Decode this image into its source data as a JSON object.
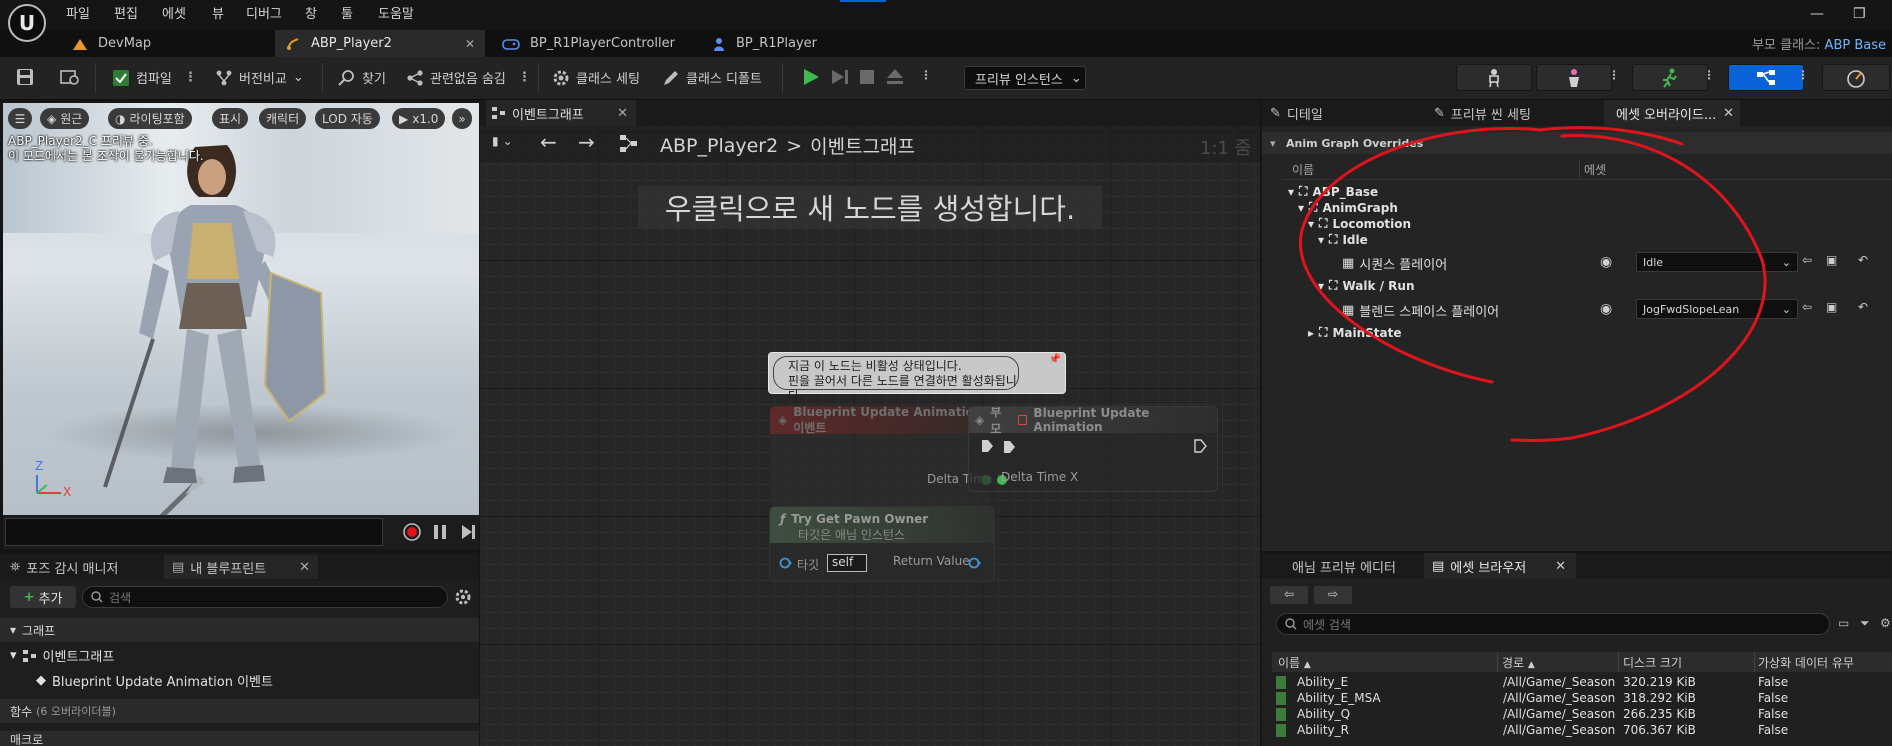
{
  "menu": [
    "파일",
    "편집",
    "에셋",
    "뷰",
    "디버그",
    "창",
    "툴",
    "도움말"
  ],
  "logo_text": "U",
  "tabs": [
    {
      "label": "DevMap"
    },
    {
      "label": "ABP_Player2"
    },
    {
      "label": "BP_R1PlayerController"
    },
    {
      "label": "BP_R1Player"
    }
  ],
  "parent_class": {
    "label": "부모 클래스:",
    "value": "ABP Base"
  },
  "toolbar": {
    "compile": "컴파일",
    "diff": "버전비교",
    "find": "찾기",
    "hide_unrelated": "관련없음 숨김",
    "class_settings": "클래스 세팅",
    "class_defaults": "클래스 디폴트",
    "preview_instance": "프리뷰 인스턴스"
  },
  "viewport": {
    "perspective": "원근",
    "lighting": "라이팅포함",
    "show": "표시",
    "character": "캐릭터",
    "lod": "LOD 자동",
    "speed": "x1.0",
    "message_line1": "ABP_Player2_C 프리뷰 중.",
    "message_line2": "이 모드에서는 본 조작이 불가능합니다.",
    "axis_z": "Z",
    "axis_x": "X"
  },
  "left_tabs": {
    "pose_watch": "포즈 감시 매니저",
    "my_blueprint": "내 블루프린트"
  },
  "my_blueprint": {
    "add": "추가",
    "search_placeholder": "검색",
    "graph_section": "그래프",
    "event_graph": "이벤트그래프",
    "event_item": "Blueprint Update Animation 이벤트",
    "functions_section": "함수",
    "functions_count": "(6 오버라이더블)",
    "macros_section": "매크로"
  },
  "graph": {
    "tab": "이벤트그래프",
    "breadcrumb_root": "ABP_Player2",
    "breadcrumb_sep": ">",
    "breadcrumb_leaf": "이벤트그래프",
    "zoom": "1:1 줌",
    "hint": "우클릭으로 새 노드를 생성합니다.",
    "tooltip_line1": "지금 이 노드는 비활성 상태입니다.",
    "tooltip_line2": "핀을 끌어서 다른 노드를 연결하면 활성화됩니다.",
    "node_event_title": "Blueprint Update Animation 이벤트",
    "node_parent_prefix": "부모",
    "node_parent_title": "Blueprint Update Animation",
    "delta_time": "Delta Time X",
    "pawn_title": "Try Get Pawn Owner",
    "pawn_subtitle": "타깃은 애님 인스턴스",
    "target_label": "타깃",
    "target_value": "self",
    "return_value": "Return Value"
  },
  "right_tabs": {
    "details": "디테일",
    "preview_scene": "프리뷰 씬 세팅",
    "asset_overrides": "에셋 오버라이드..."
  },
  "overrides": {
    "section": "Anim Graph Overrides",
    "col_name": "이름",
    "col_asset": "에셋",
    "tree": {
      "base": "ABP_Base",
      "animgraph": "AnimGraph",
      "locomotion": "Locomotion",
      "idle": "Idle",
      "seq_player": "시퀀스 플레이어",
      "seq_value": "Idle",
      "walkrun": "Walk / Run",
      "bs_player": "블렌드 스페이스 플레이어",
      "bs_value": "JogFwdSlopeLean",
      "mainstate": "MainState"
    }
  },
  "bottom_right_tabs": {
    "anim_preview": "애님 프리뷰 에디터",
    "asset_browser": "에셋 브라우저"
  },
  "asset_browser": {
    "search_placeholder": "에셋 검색",
    "columns": [
      "이름",
      "경로",
      "디스크 크기",
      "가상화 데이터 유무"
    ],
    "rows": [
      {
        "name": "Ability_E",
        "path": "/All/Game/_Season",
        "size": "320.219 KiB",
        "virt": "False"
      },
      {
        "name": "Ability_E_MSA",
        "path": "/All/Game/_Season",
        "size": "318.292 KiB",
        "virt": "False"
      },
      {
        "name": "Ability_Q",
        "path": "/All/Game/_Season",
        "size": "266.235 KiB",
        "virt": "False"
      },
      {
        "name": "Ability_R",
        "path": "/All/Game/_Season",
        "size": "706.367 KiB",
        "virt": "False"
      }
    ]
  },
  "colors": {
    "accent_blue": "#0a62d8",
    "play_green": "#3fb950",
    "annotation_red": "#e0141c",
    "link_blue": "#6fb4ff"
  }
}
